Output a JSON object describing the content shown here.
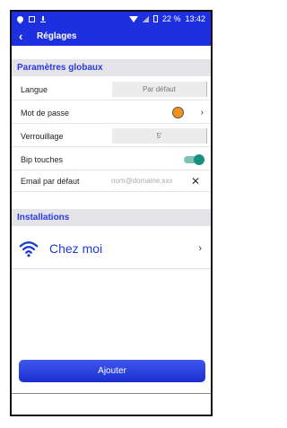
{
  "status_bar": {
    "battery": "22 %",
    "time": "13:42"
  },
  "app_bar": {
    "back_icon": "back-chevron-icon",
    "title": "Réglages"
  },
  "global_settings": {
    "header": "Paramètres globaux",
    "language": {
      "label": "Langue",
      "value": "Par défaut"
    },
    "password": {
      "label": "Mot de passe",
      "status_color": "#f0931c"
    },
    "lock": {
      "label": "Verrouillage",
      "value": "5'"
    },
    "key_beep": {
      "label": "Bip touches",
      "enabled": true
    },
    "default_email": {
      "label": "Email par défaut",
      "placeholder": "nom@domaine.xxx"
    }
  },
  "installations": {
    "header": "Installations",
    "items": [
      {
        "name": "Chez moi",
        "icon": "wifi-icon"
      }
    ]
  },
  "add_button": {
    "label": "Ajouter"
  },
  "colors": {
    "primary": "#1e2fe0",
    "section_text": "#2a3adf",
    "section_bg": "#e4e4e8",
    "toggle_on": "#1b8f7e"
  }
}
